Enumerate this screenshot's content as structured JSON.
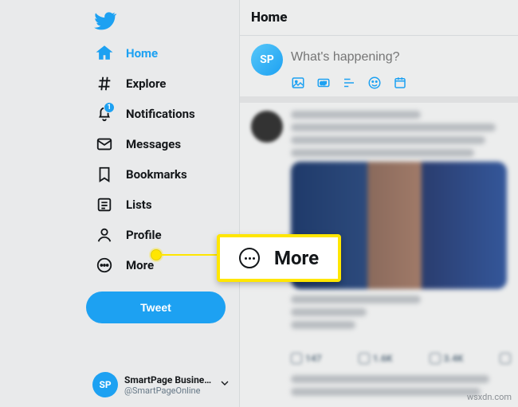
{
  "sidebar": {
    "items": [
      {
        "label": "Home",
        "icon": "home-icon",
        "active": true
      },
      {
        "label": "Explore",
        "icon": "hash-icon"
      },
      {
        "label": "Notifications",
        "icon": "bell-icon",
        "badge": "1"
      },
      {
        "label": "Messages",
        "icon": "mail-icon"
      },
      {
        "label": "Bookmarks",
        "icon": "bookmark-icon"
      },
      {
        "label": "Lists",
        "icon": "list-icon"
      },
      {
        "label": "Profile",
        "icon": "profile-icon"
      },
      {
        "label": "More",
        "icon": "more-icon"
      }
    ],
    "tweet_label": "Tweet"
  },
  "account": {
    "initials": "SP",
    "name": "SmartPage Business...",
    "handle": "@SmartPageOnline"
  },
  "header": {
    "title": "Home"
  },
  "compose": {
    "avatar_initials": "SP",
    "placeholder": "What's happening?"
  },
  "callout": {
    "text": "More"
  },
  "feed": {
    "actions": {
      "reply": "147",
      "retweet": "1.6K",
      "like": "3.4K"
    }
  },
  "watermark": "wsxdn.com"
}
